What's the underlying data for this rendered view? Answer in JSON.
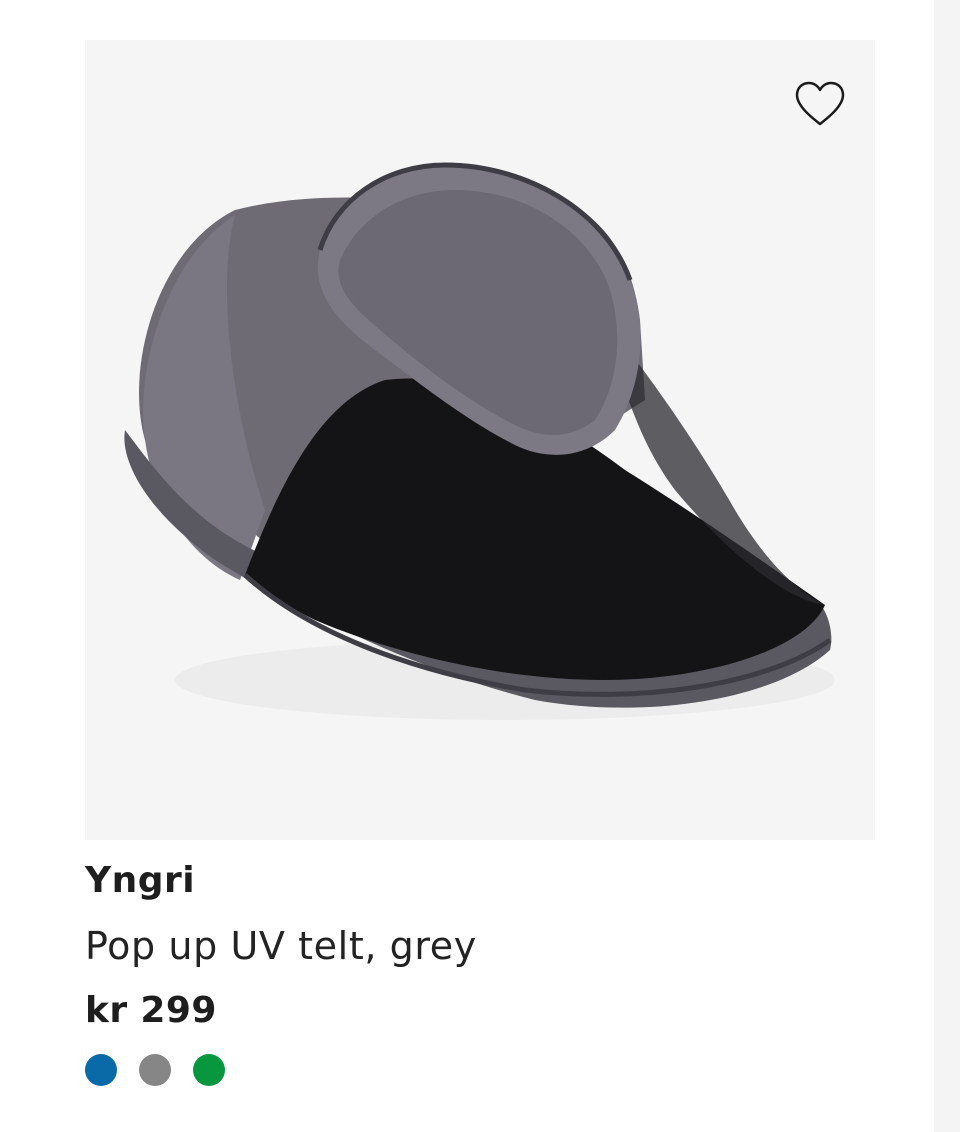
{
  "product": {
    "brand": "Yngri",
    "name": "Pop up UV telt, grey",
    "price": "kr 299",
    "image_alt": "Pop up UV telt, grey",
    "wishlist_icon": "heart-outline-icon",
    "swatches": [
      {
        "label": "blue",
        "color": "#0a6aa8"
      },
      {
        "label": "grey",
        "color": "#868686"
      },
      {
        "label": "green",
        "color": "#08963f"
      }
    ]
  }
}
